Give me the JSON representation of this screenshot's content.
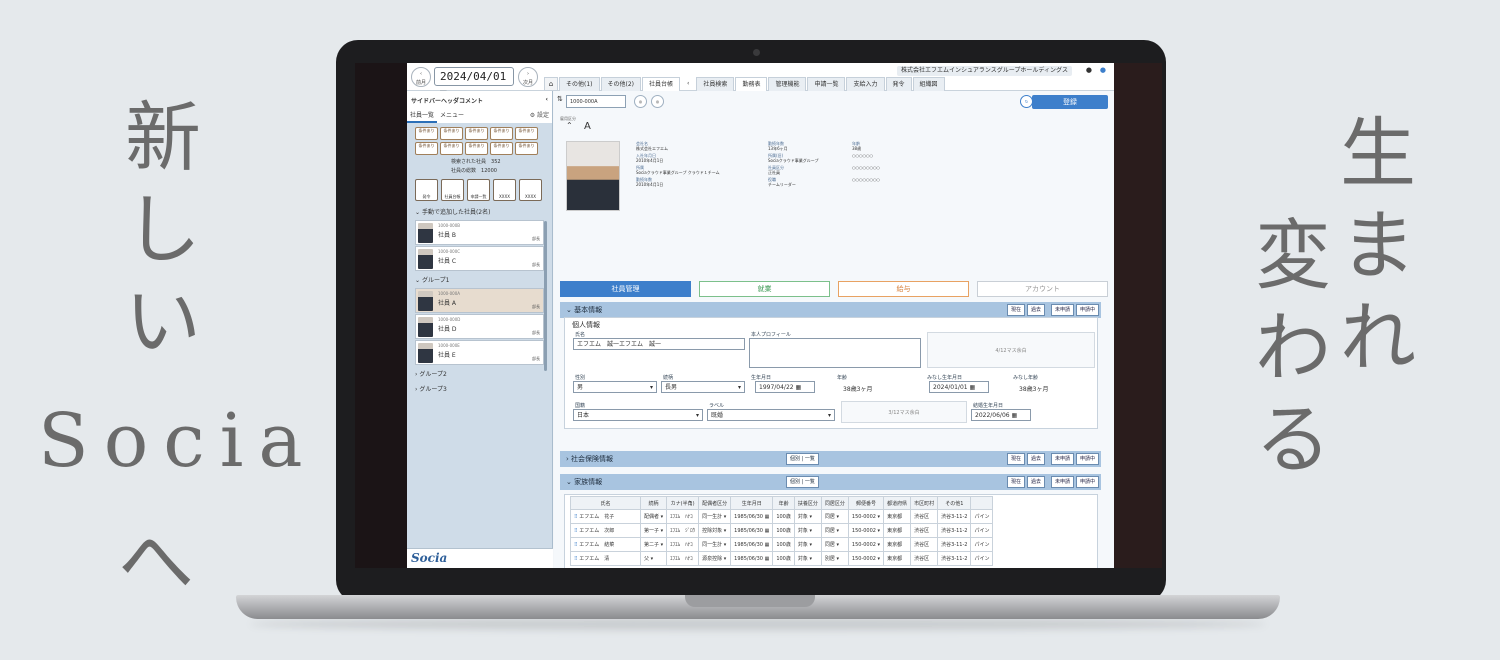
{
  "taglines": {
    "left_chars": [
      "新",
      "し",
      "い"
    ],
    "left_word": "Socia",
    "left_last": "へ",
    "right1_chars": [
      "生",
      "ま",
      "れ"
    ],
    "right2_chars": [
      "変",
      "わ",
      "る"
    ]
  },
  "topbar": {
    "prev_label": "前月",
    "next_label": "次月",
    "date": "2024/04/01",
    "company": "株式会社エフエムインシュアランスグループホールディングス",
    "tabs": [
      "その他(1)",
      "その他(2)",
      "社員台帳",
      "社員検索",
      "勤務表",
      "管理機能",
      "申請一覧",
      "支給入力",
      "発令",
      "組織図"
    ]
  },
  "sidebar": {
    "header": "サイドバーヘッダコメント",
    "tab_list": "社員一覧",
    "tab_menu": "メニュー",
    "settings": "設定",
    "grid_buttons": [
      "条件あり",
      "条件あり",
      "条件あり",
      "条件あり",
      "条件あり",
      "条件あり",
      "条件あり",
      "条件あり",
      "条件あり",
      "条件あり"
    ],
    "found_label": "検索された社員",
    "found_count": "352",
    "total_label": "社員の総数",
    "total_count": "12000",
    "icon_buttons": [
      "発令",
      "社員台帳",
      "申請一覧",
      "XXXX",
      "XXXX"
    ],
    "group_added": "手動で追加した社員(2名)",
    "group1": "グループ1",
    "group2": "グループ2",
    "group3": "グループ3",
    "employees": [
      {
        "num": "1000-000B",
        "name": "社員 B",
        "role": "部長"
      },
      {
        "num": "1000-000C",
        "name": "社員 C",
        "role": "部長"
      },
      {
        "num": "1000-000A",
        "name": "社員 A",
        "role": "部長"
      },
      {
        "num": "1000-000D",
        "name": "社員 D",
        "role": "部長"
      },
      {
        "num": "1000-000E",
        "name": "社員 E",
        "role": "部長"
      }
    ],
    "logo": "Socia"
  },
  "main": {
    "search_value": "1000-000A",
    "register": "登録",
    "emp_head": "雇用区分",
    "emp_name": "A",
    "info": [
      {
        "k": "会社名",
        "v": "株式会社エフエム"
      },
      {
        "k": "勤続年数",
        "v": "13年6ヶ月"
      },
      {
        "k": "年齢",
        "v": "38歳"
      },
      {
        "k": "入社年月日",
        "v": "2010年4月1日"
      },
      {
        "k": "所属(旧)",
        "v": "Sociaクラウド事業グループ"
      },
      {
        "k": "",
        "v": "○○○○○○"
      },
      {
        "k": "所属",
        "v": "Sociaクラウド事業グループ クラウド１チーム"
      },
      {
        "k": "社員区分",
        "v": "正社員"
      },
      {
        "k": "",
        "v": "○○○○○○○○"
      },
      {
        "k": "勤続年数",
        "v": "2010年4月1日"
      },
      {
        "k": "役職",
        "v": "チームリーダー"
      },
      {
        "k": "",
        "v": "○○○○○○○○"
      }
    ],
    "big_tabs": [
      "社員管理",
      "就業",
      "給与",
      "アカウント"
    ],
    "sec_basic": "基本情報",
    "sec_social": "社会保険情報",
    "sec_family": "家族情報",
    "btn_current": "現在",
    "btn_past": "過去",
    "btn_unapplied": "未申請",
    "btn_applying": "申請中",
    "btn_kobetsu": "個別",
    "btn_ichiran": "一覧",
    "personal_title": "個人情報",
    "fields": {
      "name_label": "氏名",
      "name_value": "エフエム　誠一エフエム　誠一",
      "profile_label": "本人プロフィール",
      "quota1": "4/12マス余白",
      "gender_label": "性別",
      "gender_value": "男",
      "relation_label": "続柄",
      "relation_value": "長男",
      "birth_label": "生年月日",
      "birth_value": "1997/04/22",
      "age_label": "年齢",
      "age_value": "38歳3ヶ月",
      "deemed_label": "みなし生年月日",
      "deemed_value": "2024/01/01",
      "deemed_age_label": "みなし年齢",
      "deemed_age_value": "38歳3ヶ月",
      "country_label": "国籍",
      "country_value": "日本",
      "label_label": "ラベル",
      "label_value": "既婚",
      "quota2": "3/12マス余白",
      "marriage_label": "結婚生年月日",
      "marriage_value": "2022/06/06"
    },
    "family_headers": [
      "氏名",
      "続柄",
      "カナ(半角)",
      "配偶者区分",
      "生年月日",
      "年齢",
      "扶養区分",
      "同居区分",
      "郵便番号",
      "都道府県",
      "市区町村",
      "その他1",
      ""
    ],
    "family_rows": [
      [
        "エフエム　花子",
        "配偶者",
        "ｴﾌｴﾑ　ﾊﾅｺ",
        "同一生計",
        "1985/06/30",
        "100歳",
        "対象",
        "同居",
        "150-0002",
        "東京都",
        "渋谷区",
        "渋谷3-11-2",
        "パイン"
      ],
      [
        "エフエム　次郎",
        "第一子",
        "ｴﾌｴﾑ　ｼﾞﾛｳ",
        "控除対象",
        "1985/06/30",
        "100歳",
        "対象",
        "同居",
        "150-0002",
        "東京都",
        "渋谷区",
        "渋谷3-11-2",
        "パイン"
      ],
      [
        "エフエム　結菜",
        "第二子",
        "ｴﾌｴﾑ　ﾊﾅｺ",
        "同一生計",
        "1985/06/30",
        "100歳",
        "対象",
        "同居",
        "150-0002",
        "東京都",
        "渋谷区",
        "渋谷3-11-2",
        "パイン"
      ],
      [
        "エフエム　清",
        "父",
        "ｴﾌｴﾑ　ﾊﾅｺ",
        "源泉控除",
        "1985/06/30",
        "100歳",
        "対象",
        "別居",
        "150-0002",
        "東京都",
        "渋谷区",
        "渋谷3-11-2",
        "パイン"
      ]
    ]
  }
}
